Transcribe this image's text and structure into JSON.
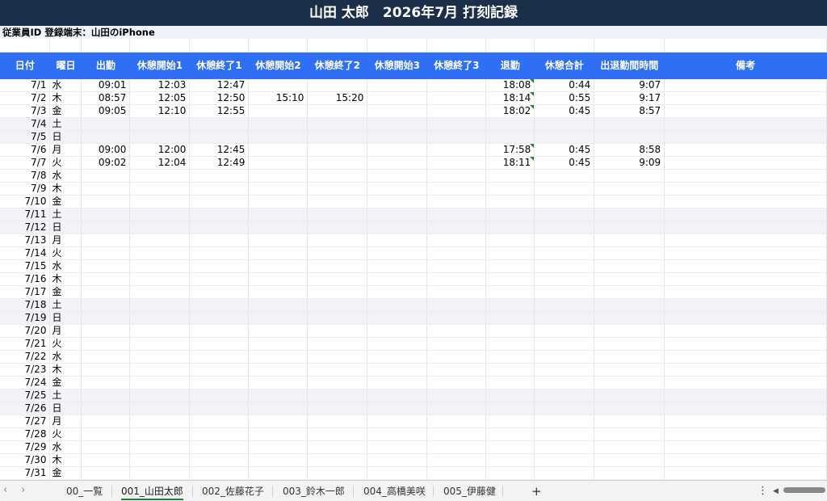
{
  "sheet": {
    "title": "山田 太郎　2026年7月 打刻記録",
    "subtitle": "従業員ID 登録端末：山田のiPhone"
  },
  "columns": [
    "日付",
    "曜日",
    "出勤",
    "休憩開始1",
    "休憩終了1",
    "休憩開始2",
    "休憩終了2",
    "休憩開始3",
    "休憩終了3",
    "退勤",
    "休憩合計",
    "出退勤間時間",
    "備考"
  ],
  "rows": [
    {
      "date": "7/1",
      "day": "水",
      "in": "09:01",
      "bs1": "12:03",
      "be1": "12:47",
      "bs2": "",
      "be2": "",
      "bs3": "",
      "be3": "",
      "out": "18:08",
      "brk": "0:44",
      "span": "9:07",
      "note": "",
      "weekend": false,
      "flag": true
    },
    {
      "date": "7/2",
      "day": "木",
      "in": "08:57",
      "bs1": "12:05",
      "be1": "12:50",
      "bs2": "15:10",
      "be2": "15:20",
      "bs3": "",
      "be3": "",
      "out": "18:14",
      "brk": "0:55",
      "span": "9:17",
      "note": "",
      "weekend": false,
      "flag": true
    },
    {
      "date": "7/3",
      "day": "金",
      "in": "09:05",
      "bs1": "12:10",
      "be1": "12:55",
      "bs2": "",
      "be2": "",
      "bs3": "",
      "be3": "",
      "out": "18:02",
      "brk": "0:45",
      "span": "8:57",
      "note": "",
      "weekend": false,
      "flag": true
    },
    {
      "date": "7/4",
      "day": "土",
      "in": "",
      "bs1": "",
      "be1": "",
      "bs2": "",
      "be2": "",
      "bs3": "",
      "be3": "",
      "out": "",
      "brk": "",
      "span": "",
      "note": "",
      "weekend": true,
      "flag": false
    },
    {
      "date": "7/5",
      "day": "日",
      "in": "",
      "bs1": "",
      "be1": "",
      "bs2": "",
      "be2": "",
      "bs3": "",
      "be3": "",
      "out": "",
      "brk": "",
      "span": "",
      "note": "",
      "weekend": true,
      "flag": false
    },
    {
      "date": "7/6",
      "day": "月",
      "in": "09:00",
      "bs1": "12:00",
      "be1": "12:45",
      "bs2": "",
      "be2": "",
      "bs3": "",
      "be3": "",
      "out": "17:58",
      "brk": "0:45",
      "span": "8:58",
      "note": "",
      "weekend": false,
      "flag": true
    },
    {
      "date": "7/7",
      "day": "火",
      "in": "09:02",
      "bs1": "12:04",
      "be1": "12:49",
      "bs2": "",
      "be2": "",
      "bs3": "",
      "be3": "",
      "out": "18:11",
      "brk": "0:45",
      "span": "9:09",
      "note": "",
      "weekend": false,
      "flag": true
    },
    {
      "date": "7/8",
      "day": "水",
      "in": "",
      "bs1": "",
      "be1": "",
      "bs2": "",
      "be2": "",
      "bs3": "",
      "be3": "",
      "out": "",
      "brk": "",
      "span": "",
      "note": "",
      "weekend": false,
      "flag": false
    },
    {
      "date": "7/9",
      "day": "木",
      "in": "",
      "bs1": "",
      "be1": "",
      "bs2": "",
      "be2": "",
      "bs3": "",
      "be3": "",
      "out": "",
      "brk": "",
      "span": "",
      "note": "",
      "weekend": false,
      "flag": false
    },
    {
      "date": "7/10",
      "day": "金",
      "in": "",
      "bs1": "",
      "be1": "",
      "bs2": "",
      "be2": "",
      "bs3": "",
      "be3": "",
      "out": "",
      "brk": "",
      "span": "",
      "note": "",
      "weekend": false,
      "flag": false
    },
    {
      "date": "7/11",
      "day": "土",
      "in": "",
      "bs1": "",
      "be1": "",
      "bs2": "",
      "be2": "",
      "bs3": "",
      "be3": "",
      "out": "",
      "brk": "",
      "span": "",
      "note": "",
      "weekend": true,
      "flag": false
    },
    {
      "date": "7/12",
      "day": "日",
      "in": "",
      "bs1": "",
      "be1": "",
      "bs2": "",
      "be2": "",
      "bs3": "",
      "be3": "",
      "out": "",
      "brk": "",
      "span": "",
      "note": "",
      "weekend": true,
      "flag": false
    },
    {
      "date": "7/13",
      "day": "月",
      "in": "",
      "bs1": "",
      "be1": "",
      "bs2": "",
      "be2": "",
      "bs3": "",
      "be3": "",
      "out": "",
      "brk": "",
      "span": "",
      "note": "",
      "weekend": false,
      "flag": false
    },
    {
      "date": "7/14",
      "day": "火",
      "in": "",
      "bs1": "",
      "be1": "",
      "bs2": "",
      "be2": "",
      "bs3": "",
      "be3": "",
      "out": "",
      "brk": "",
      "span": "",
      "note": "",
      "weekend": false,
      "flag": false
    },
    {
      "date": "7/15",
      "day": "水",
      "in": "",
      "bs1": "",
      "be1": "",
      "bs2": "",
      "be2": "",
      "bs3": "",
      "be3": "",
      "out": "",
      "brk": "",
      "span": "",
      "note": "",
      "weekend": false,
      "flag": false
    },
    {
      "date": "7/16",
      "day": "木",
      "in": "",
      "bs1": "",
      "be1": "",
      "bs2": "",
      "be2": "",
      "bs3": "",
      "be3": "",
      "out": "",
      "brk": "",
      "span": "",
      "note": "",
      "weekend": false,
      "flag": false
    },
    {
      "date": "7/17",
      "day": "金",
      "in": "",
      "bs1": "",
      "be1": "",
      "bs2": "",
      "be2": "",
      "bs3": "",
      "be3": "",
      "out": "",
      "brk": "",
      "span": "",
      "note": "",
      "weekend": false,
      "flag": false
    },
    {
      "date": "7/18",
      "day": "土",
      "in": "",
      "bs1": "",
      "be1": "",
      "bs2": "",
      "be2": "",
      "bs3": "",
      "be3": "",
      "out": "",
      "brk": "",
      "span": "",
      "note": "",
      "weekend": true,
      "flag": false
    },
    {
      "date": "7/19",
      "day": "日",
      "in": "",
      "bs1": "",
      "be1": "",
      "bs2": "",
      "be2": "",
      "bs3": "",
      "be3": "",
      "out": "",
      "brk": "",
      "span": "",
      "note": "",
      "weekend": true,
      "flag": false
    },
    {
      "date": "7/20",
      "day": "月",
      "in": "",
      "bs1": "",
      "be1": "",
      "bs2": "",
      "be2": "",
      "bs3": "",
      "be3": "",
      "out": "",
      "brk": "",
      "span": "",
      "note": "",
      "weekend": false,
      "flag": false
    },
    {
      "date": "7/21",
      "day": "火",
      "in": "",
      "bs1": "",
      "be1": "",
      "bs2": "",
      "be2": "",
      "bs3": "",
      "be3": "",
      "out": "",
      "brk": "",
      "span": "",
      "note": "",
      "weekend": false,
      "flag": false
    },
    {
      "date": "7/22",
      "day": "水",
      "in": "",
      "bs1": "",
      "be1": "",
      "bs2": "",
      "be2": "",
      "bs3": "",
      "be3": "",
      "out": "",
      "brk": "",
      "span": "",
      "note": "",
      "weekend": false,
      "flag": false
    },
    {
      "date": "7/23",
      "day": "木",
      "in": "",
      "bs1": "",
      "be1": "",
      "bs2": "",
      "be2": "",
      "bs3": "",
      "be3": "",
      "out": "",
      "brk": "",
      "span": "",
      "note": "",
      "weekend": false,
      "flag": false
    },
    {
      "date": "7/24",
      "day": "金",
      "in": "",
      "bs1": "",
      "be1": "",
      "bs2": "",
      "be2": "",
      "bs3": "",
      "be3": "",
      "out": "",
      "brk": "",
      "span": "",
      "note": "",
      "weekend": false,
      "flag": false
    },
    {
      "date": "7/25",
      "day": "土",
      "in": "",
      "bs1": "",
      "be1": "",
      "bs2": "",
      "be2": "",
      "bs3": "",
      "be3": "",
      "out": "",
      "brk": "",
      "span": "",
      "note": "",
      "weekend": true,
      "flag": false
    },
    {
      "date": "7/26",
      "day": "日",
      "in": "",
      "bs1": "",
      "be1": "",
      "bs2": "",
      "be2": "",
      "bs3": "",
      "be3": "",
      "out": "",
      "brk": "",
      "span": "",
      "note": "",
      "weekend": true,
      "flag": false
    },
    {
      "date": "7/27",
      "day": "月",
      "in": "",
      "bs1": "",
      "be1": "",
      "bs2": "",
      "be2": "",
      "bs3": "",
      "be3": "",
      "out": "",
      "brk": "",
      "span": "",
      "note": "",
      "weekend": false,
      "flag": false
    },
    {
      "date": "7/28",
      "day": "火",
      "in": "",
      "bs1": "",
      "be1": "",
      "bs2": "",
      "be2": "",
      "bs3": "",
      "be3": "",
      "out": "",
      "brk": "",
      "span": "",
      "note": "",
      "weekend": false,
      "flag": false
    },
    {
      "date": "7/29",
      "day": "水",
      "in": "",
      "bs1": "",
      "be1": "",
      "bs2": "",
      "be2": "",
      "bs3": "",
      "be3": "",
      "out": "",
      "brk": "",
      "span": "",
      "note": "",
      "weekend": false,
      "flag": false
    },
    {
      "date": "7/30",
      "day": "木",
      "in": "",
      "bs1": "",
      "be1": "",
      "bs2": "",
      "be2": "",
      "bs3": "",
      "be3": "",
      "out": "",
      "brk": "",
      "span": "",
      "note": "",
      "weekend": false,
      "flag": false
    },
    {
      "date": "7/31",
      "day": "金",
      "in": "",
      "bs1": "",
      "be1": "",
      "bs2": "",
      "be2": "",
      "bs3": "",
      "be3": "",
      "out": "",
      "brk": "",
      "span": "",
      "note": "",
      "weekend": false,
      "flag": false
    }
  ],
  "tabs": {
    "prev_icon": "chevron-left-icon",
    "next_icon": "chevron-right-icon",
    "items": [
      {
        "label": "00_一覧",
        "active": false
      },
      {
        "label": "001_山田太郎",
        "active": true
      },
      {
        "label": "002_佐藤花子",
        "active": false
      },
      {
        "label": "003_鈴木一郎",
        "active": false
      },
      {
        "label": "004_高橋美咲",
        "active": false
      },
      {
        "label": "005_伊藤健",
        "active": false
      }
    ],
    "add_label": "+",
    "more_label": "⋮",
    "scroll_left_label": "◀"
  },
  "colors": {
    "title_bg": "#1c2f49",
    "header_bg": "#2f6ff3",
    "weekend_bg": "#f1f3f7",
    "flag": "#1f8a3a",
    "active_tab_underline": "#1e7e34"
  }
}
